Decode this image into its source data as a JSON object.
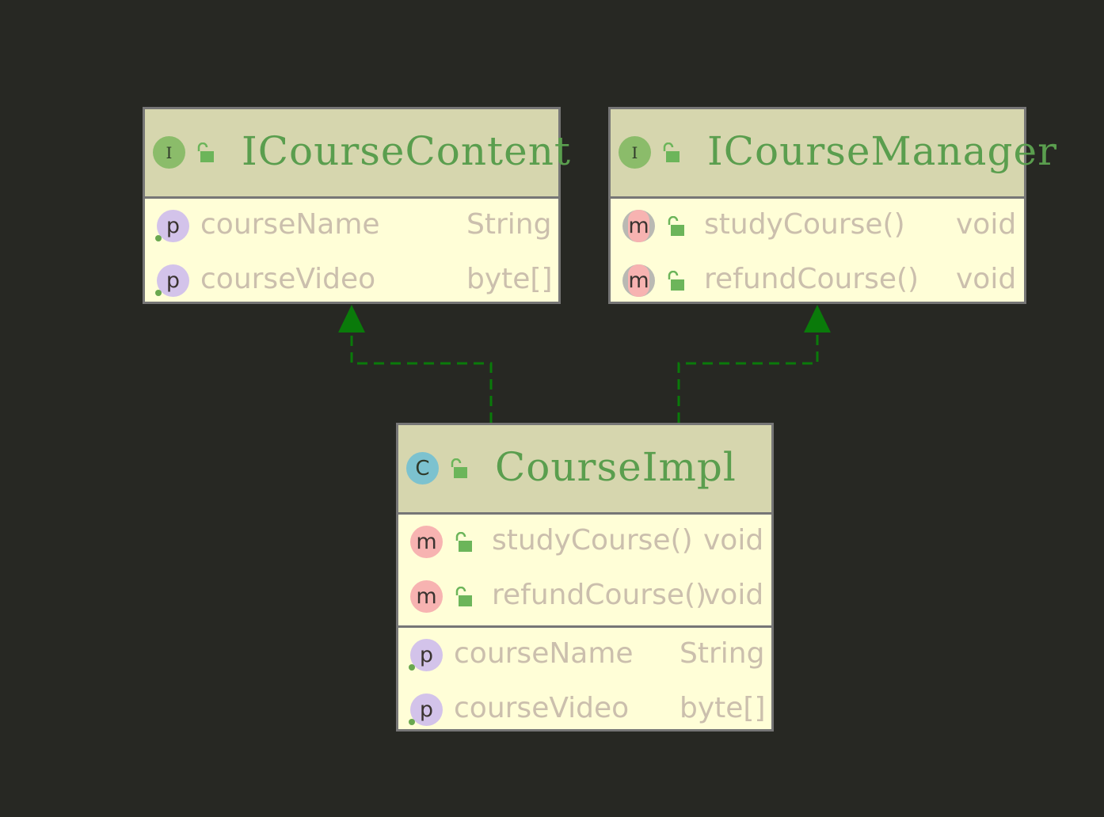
{
  "nodes": {
    "icoursecontent": {
      "kind": "I",
      "title": "ICourseContent",
      "fields": [
        {
          "badge": "p",
          "name": "courseName",
          "type": "String"
        },
        {
          "badge": "p",
          "name": "courseVideo",
          "type": "byte[]"
        }
      ]
    },
    "icoursemanager": {
      "kind": "I",
      "title": "ICourseManager",
      "methods": [
        {
          "badge": "m",
          "name": "studyCourse()",
          "type": "void"
        },
        {
          "badge": "m",
          "name": "refundCourse()",
          "type": "void"
        }
      ]
    },
    "courseimpl": {
      "kind": "C",
      "title": "CourseImpl",
      "methods": [
        {
          "badge": "m",
          "name": "studyCourse()",
          "type": "void"
        },
        {
          "badge": "m",
          "name": "refundCourse()",
          "type": "void"
        }
      ],
      "fields": [
        {
          "badge": "p",
          "name": "courseName",
          "type": "String"
        },
        {
          "badge": "p",
          "name": "courseVideo",
          "type": "byte[]"
        }
      ]
    }
  },
  "edges": [
    {
      "from": "courseimpl",
      "to": "icoursecontent",
      "kind": "implements"
    },
    {
      "from": "courseimpl",
      "to": "icoursemanager",
      "kind": "implements"
    }
  ],
  "colors": {
    "background": "#272823",
    "node_body": "#fffed7",
    "node_header": "#d6d6ae",
    "border": "#767676",
    "title": "#5a9e4e",
    "member_text": "#cbbfad",
    "edge": "#0a7a0a",
    "lock": "#6cb55a"
  },
  "icons": {
    "interface_badge": "interface-icon",
    "class_badge": "class-icon",
    "property_badge": "property-icon",
    "method_badge": "method-icon",
    "visibility": "open-lock-icon",
    "arrowhead": "hollow-triangle-arrow"
  }
}
